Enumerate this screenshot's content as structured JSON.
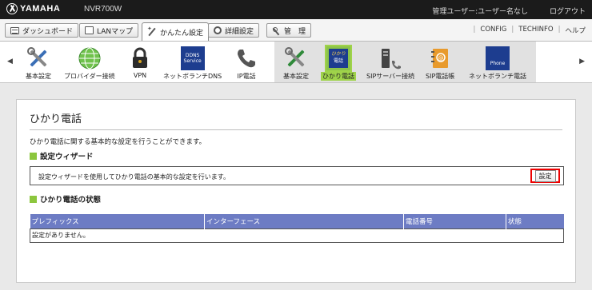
{
  "topbar": {
    "logo": "YAMAHA",
    "model": "NVR700W",
    "user_info": "管理ユーザー:ユーザー名なし",
    "logout": "ログアウト"
  },
  "menubar": {
    "items": [
      {
        "label": "ダッシュボード",
        "icon": "dashboard-icon"
      },
      {
        "label": "LANマップ",
        "icon": "lan-map-icon"
      },
      {
        "label": "かんたん設定",
        "icon": "wizard-icon"
      },
      {
        "label": "詳細設定",
        "icon": "gear-icon"
      },
      {
        "label": "管　理",
        "icon": "tool-icon"
      }
    ],
    "right_links": [
      "CONFIG",
      "TECHINFO",
      "ヘルプ"
    ]
  },
  "iconbar": {
    "prev": "◀",
    "next": "▶",
    "items": [
      {
        "label": "基本設定",
        "icon": "tools-icon"
      },
      {
        "label": "プロバイダー接続",
        "icon": "globe-icon"
      },
      {
        "label": "VPN",
        "icon": "vpn-lock-icon"
      },
      {
        "label": "ネットボランチDNS",
        "icon": "dns-icon",
        "icon_text": [
          "DDNS",
          "Service"
        ]
      },
      {
        "label": "IP電話",
        "icon": "phone-icon"
      },
      {
        "label": "基本設定",
        "icon": "tools-icon"
      },
      {
        "label": "ひかり電話",
        "icon": "hikari-phone-icon",
        "icon_text": [
          "ひかり",
          "電話"
        ],
        "current": true
      },
      {
        "label": "SIPサーバー接続",
        "icon": "sip-server-icon"
      },
      {
        "label": "SIP電話帳",
        "icon": "phonebook-icon"
      },
      {
        "label": "ネットボランチ電話",
        "icon": "netvolante-phone-icon",
        "icon_text": [
          "Phone"
        ]
      }
    ]
  },
  "main": {
    "title": "ひかり電話",
    "description": "ひかり電話に関する基本的な設定を行うことができます。",
    "wizard": {
      "heading": "設定ウィザード",
      "text": "設定ウィザードを使用してひかり電話の基本的な設定を行います。",
      "button": "設定"
    },
    "status": {
      "heading": "ひかり電話の状態",
      "columns": [
        "プレフィックス",
        "インターフェース",
        "電話番号",
        "状態"
      ],
      "empty": "設定がありません。"
    }
  },
  "colors": {
    "topbar_bg": "#1b1b1b",
    "accent_green": "#8cc63e",
    "table_header": "#6d7cc4",
    "highlight_red": "#e00000"
  }
}
